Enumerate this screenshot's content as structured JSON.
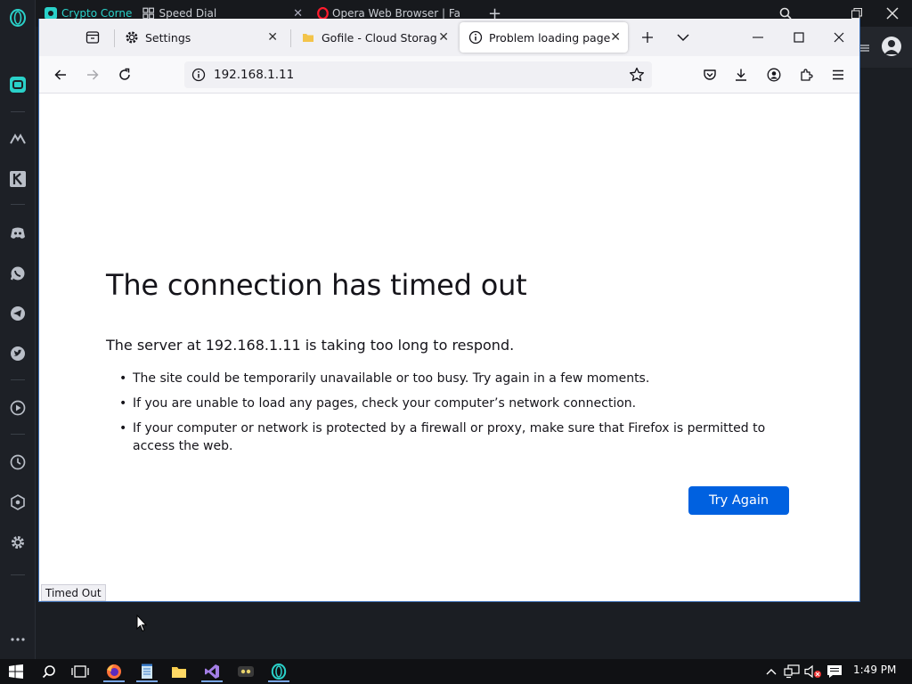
{
  "opera": {
    "tabs": [
      {
        "label": "Crypto Corne"
      },
      {
        "label": "Speed Dial"
      },
      {
        "label": "Opera Web Browser | Fa"
      }
    ],
    "new_tab_glyph": "+"
  },
  "firefox": {
    "tabs": [
      {
        "label": "Settings",
        "icon": "gear-icon"
      },
      {
        "label": "Gofile - Cloud Storage Ma",
        "icon": "folder-icon"
      },
      {
        "label": "Problem loading page",
        "icon": "info-icon",
        "active": true
      }
    ],
    "url": "192.168.1.11",
    "error": {
      "title": "The connection has timed out",
      "short_desc": "The server at 192.168.1.11 is taking too long to respond.",
      "items": [
        "The site could be temporarily unavailable or too busy. Try again in a few moments.",
        "If you are unable to load any pages, check your computer’s network connection.",
        "If your computer or network is protected by a firewall or proxy, make sure that Firefox is permitted to access the web."
      ],
      "button_label": "Try Again"
    },
    "status_text": "Timed Out"
  },
  "taskbar": {
    "clock": "1:49 PM"
  },
  "colors": {
    "accent": "#0061e0",
    "opera_accent": "#2ad1c9"
  }
}
